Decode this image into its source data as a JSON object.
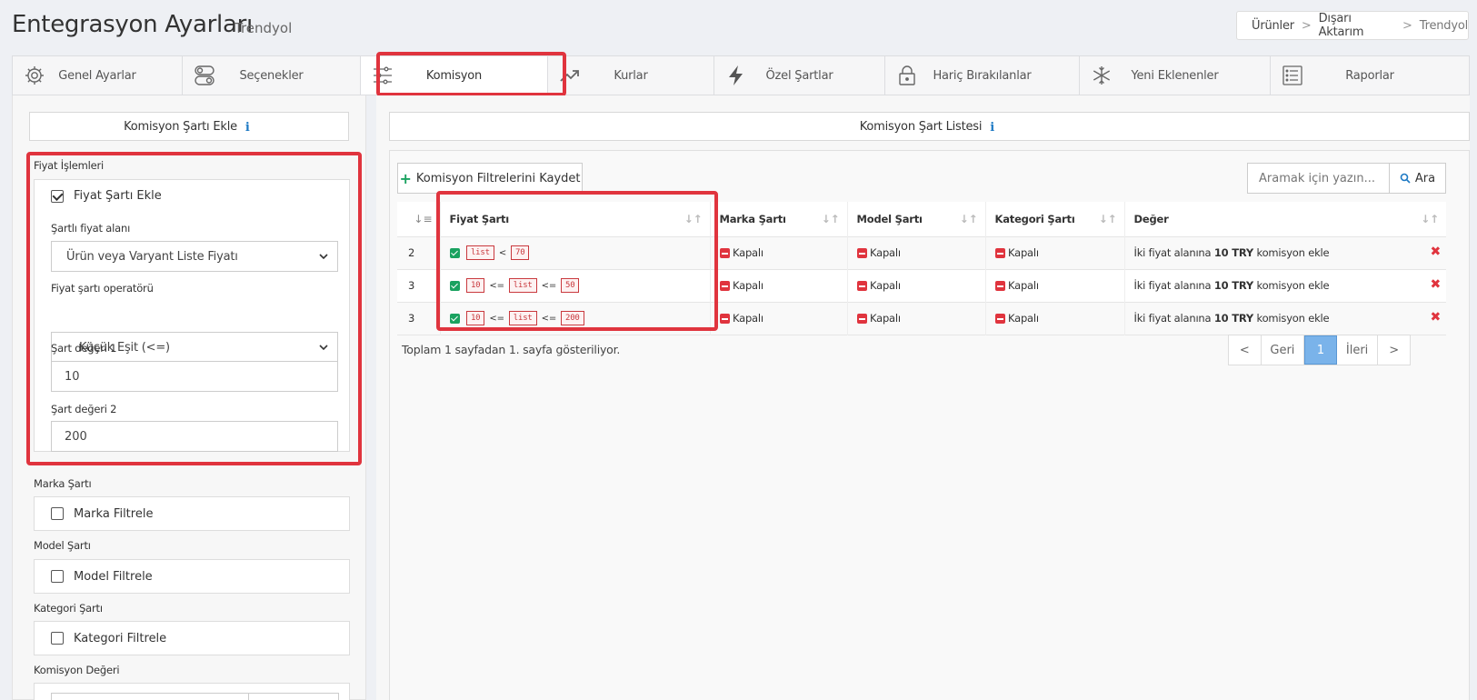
{
  "header": {
    "title": "Entegrasyon Ayarları",
    "subtitle": "Trendyol"
  },
  "breadcrumb": [
    "Ürünler",
    "Dışarı Aktarım",
    "Trendyol"
  ],
  "tabs": [
    {
      "label": "Genel Ayarlar",
      "icon": "gear-icon"
    },
    {
      "label": "Seçenekler",
      "icon": "toggles-icon"
    },
    {
      "label": "Komisyon",
      "icon": "sliders-icon",
      "active": true
    },
    {
      "label": "Kurlar",
      "icon": "trend-up-icon"
    },
    {
      "label": "Özel Şartlar",
      "icon": "lightning-icon"
    },
    {
      "label": "Hariç Bırakılanlar",
      "icon": "lock-icon"
    },
    {
      "label": "Yeni Eklenenler",
      "icon": "snowflake-icon"
    },
    {
      "label": "Raporlar",
      "icon": "list-icon"
    }
  ],
  "left_panel": {
    "title": "Komisyon Şartı Ekle",
    "price_section": {
      "label": "Fiyat İşlemleri",
      "checkbox_label": "Fiyat Şartı Ekle",
      "field_label": "Şartlı fiyat alanı",
      "field_value": "Ürün veya Varyant Liste Fiyatı",
      "operator_label": "Fiyat şartı operatörü",
      "operator_value": "Küçük Eşit (<=)",
      "value1_label": "Şart değeri 1",
      "value1": "10",
      "value2_label": "Şart değeri 2",
      "value2": "200"
    },
    "brand_section": {
      "label": "Marka Şartı",
      "checkbox_label": "Marka Filtrele"
    },
    "model_section": {
      "label": "Model Şartı",
      "checkbox_label": "Model Filtrele"
    },
    "category_section": {
      "label": "Kategori Şartı",
      "checkbox_label": "Kategori Filtrele"
    },
    "commission_label": "Komisyon Değeri"
  },
  "right_panel": {
    "title": "Komisyon Şart Listesi",
    "save_button": "Komisyon Filtrelerini Kaydet",
    "search_placeholder": "Aramak için yazın...",
    "search_button": "Ara",
    "columns": [
      "Fiyat Şartı",
      "Marka Şartı",
      "Model Şartı",
      "Kategori Şartı",
      "Değer"
    ],
    "rows": [
      {
        "id": "2",
        "cond": [
          "list",
          "<",
          "70"
        ],
        "brand": "Kapalı",
        "model": "Kapalı",
        "category": "Kapalı",
        "value_pre": "İki fiyat alanına",
        "value_bold": "10 TRY",
        "value_post": "komisyon ekle"
      },
      {
        "id": "3",
        "cond": [
          "10",
          "<=",
          "list",
          "<=",
          "50"
        ],
        "brand": "Kapalı",
        "model": "Kapalı",
        "category": "Kapalı",
        "value_pre": "İki fiyat alanına",
        "value_bold": "10 TRY",
        "value_post": "komisyon ekle"
      },
      {
        "id": "3",
        "cond": [
          "10",
          "<=",
          "list",
          "<=",
          "200"
        ],
        "brand": "Kapalı",
        "model": "Kapalı",
        "category": "Kapalı",
        "value_pre": "İki fiyat alanına",
        "value_bold": "10 TRY",
        "value_post": "komisyon ekle"
      }
    ],
    "summary": "Toplam 1 sayfadan 1. sayfa gösteriliyor.",
    "pagination": {
      "first": "<",
      "prev": "Geri",
      "current": "1",
      "next": "İleri",
      "last": ">"
    }
  },
  "colors": {
    "highlight": "#e0343e",
    "accent": "#1d79c4",
    "success": "#1aa260",
    "page_active": "#7ab3ea"
  }
}
